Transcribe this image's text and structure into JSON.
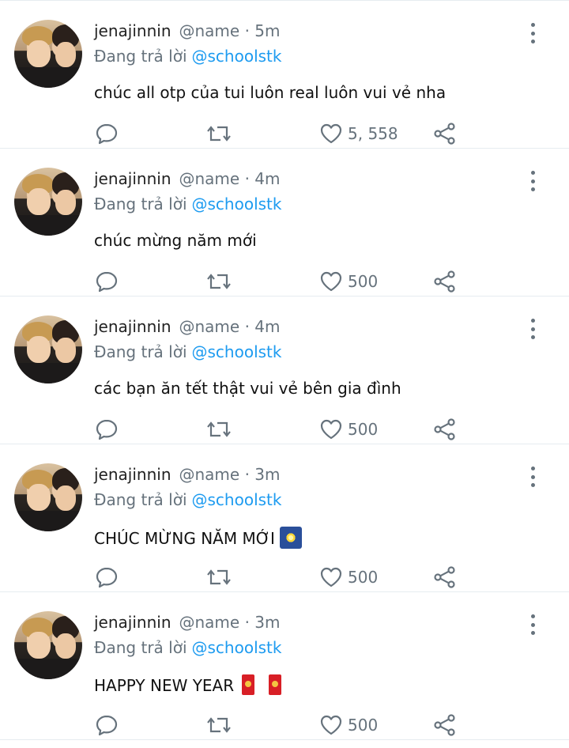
{
  "colors": {
    "accent": "#1d9bf0",
    "muted": "#66727c",
    "divider": "#e6ecf0"
  },
  "icons": {
    "comment": "comment-icon",
    "retweet": "retweet-icon",
    "like": "heart-icon",
    "share": "share-icon",
    "more": "more-vertical-icon"
  },
  "tweets": [
    {
      "name": "jenajinnin",
      "handle": "@name · 5m",
      "reply_prefix": "Đang trả lời",
      "reply_to": "@schoolstk",
      "text": "chúc all otp của tui luôn real luôn vui vẻ nha",
      "emoji": "",
      "likes": "5, 558"
    },
    {
      "name": "jenajinnin",
      "handle": "@name · 4m",
      "reply_prefix": "Đang trả lời",
      "reply_to": "@schoolstk",
      "text": "chúc mừng năm mới",
      "emoji": "",
      "likes": "500"
    },
    {
      "name": "jenajinnin",
      "handle": "@name · 4m",
      "reply_prefix": "Đang trả lời",
      "reply_to": "@schoolstk",
      "text": "các bạn ăn tết thật vui vẻ bên gia đình",
      "emoji": "",
      "likes": "500"
    },
    {
      "name": "jenajinnin",
      "handle": "@name · 3m",
      "reply_prefix": "Đang trả lời",
      "reply_to": "@schoolstk",
      "text": "CHÚC MỪNG NĂM MỚI",
      "emoji": "fireworks",
      "likes": "500"
    },
    {
      "name": "jenajinnin",
      "handle": "@name · 3m",
      "reply_prefix": "Đang trả lời",
      "reply_to": "@schoolstk",
      "text": "HAPPY NEW YEAR",
      "emoji": "red-envelopes",
      "likes": "500"
    }
  ]
}
